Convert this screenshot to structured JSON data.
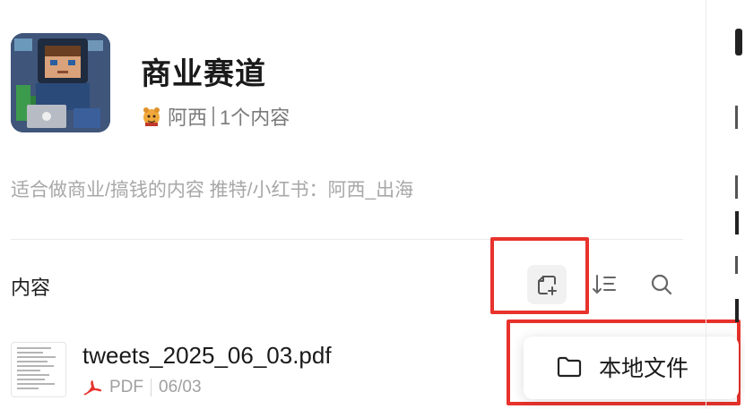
{
  "collection": {
    "title": "商业赛道",
    "author": "阿西",
    "content_count": "1个内容",
    "description": "适合做商业/搞钱的内容 推特/小红书：阿西_出海"
  },
  "content_section": {
    "label": "内容"
  },
  "toolbar": {
    "add_icon": "add-file-icon",
    "sort_icon": "sort-icon",
    "search_icon": "search-icon"
  },
  "files": [
    {
      "name": "tweets_2025_06_03.pdf",
      "type": "PDF",
      "date": "06/03"
    }
  ],
  "dropdown": {
    "items": [
      {
        "label": "本地文件",
        "icon": "folder-icon"
      }
    ]
  },
  "colors": {
    "highlight": "#e8322c",
    "pdf_icon": "#e8322c"
  }
}
